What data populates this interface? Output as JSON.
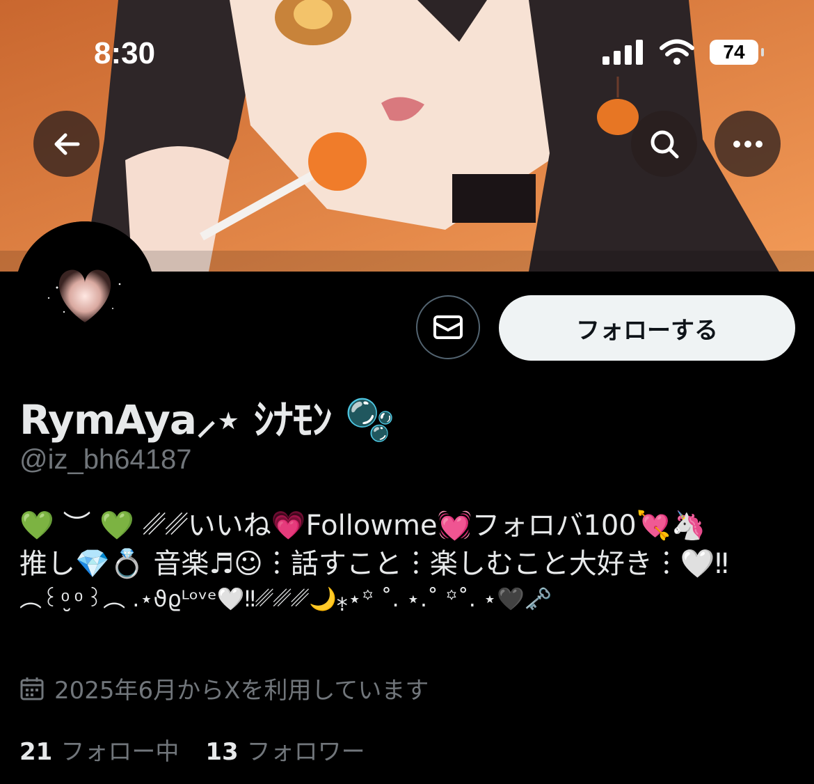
{
  "status_bar": {
    "time": "8:30",
    "battery": "74"
  },
  "profile": {
    "follow_label": "フォローする",
    "display_name": "RymAya⸝⋆ ｼﾅﾓﾝ 🫧",
    "handle": "@iz_bh64187",
    "bio_lines": [
      "💚 ︶ 💚 ␥␥いいね💗Followme💓フォロバ100💘🦄",
      "推し💎💍 音楽♬☺︎︙話すこと︙楽しむこと大好き︙🤍‼︎",
      "︵꒰ ͦ ̮ ͦ ꒱︵ .⋆ϑϱᴸᵒᵛᵉ🤍‼︎␥␥␥🌙⁎̣⋆꙳ ˚. ⋆.˚ ꙳˚. ⋆🖤🗝️"
    ],
    "joined": "2025年6月からXを利用しています",
    "following_count": "21",
    "following_label": "フォロー中",
    "followers_count": "13",
    "followers_label": "フォロワー"
  },
  "colors": {
    "background": "#000000",
    "muted_text": "#71767b",
    "primary_text": "#e7e9ea",
    "button_bg": "#eff3f4"
  },
  "icons": [
    "back-arrow-icon",
    "search-icon",
    "more-icon",
    "mail-icon",
    "calendar-icon",
    "signal-icon",
    "wifi-icon"
  ]
}
